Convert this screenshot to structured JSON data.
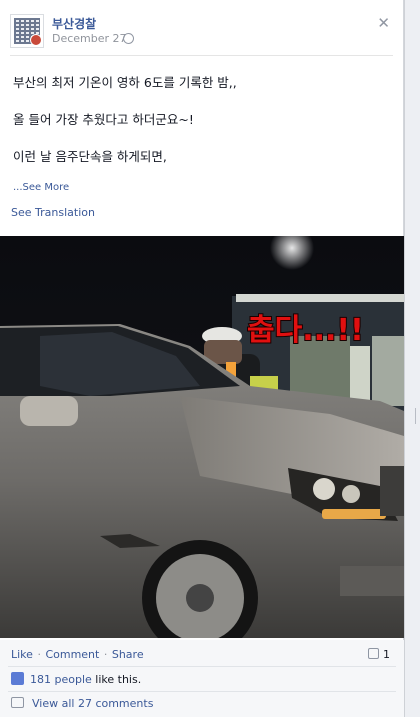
{
  "post": {
    "page_name": "부산경찰",
    "date": "December 27",
    "close_icon": "close-icon",
    "privacy_icon": "globe-icon",
    "lines": [
      "부산의 최저 기온이 영하 6도를 기록한 밤,,",
      "올 들어 가장 추웠다고 하더군요~!",
      "이런 날 음주단속을 하게되면,"
    ],
    "see_more": "...See More",
    "see_translation": "See Translation"
  },
  "photo": {
    "caption": "춥다...!!"
  },
  "actions": {
    "like": "Like",
    "comment": "Comment",
    "share": "Share",
    "comment_count": "1"
  },
  "likes": {
    "count_link": "181 people",
    "suffix": " like this."
  },
  "comments": {
    "view_all": "View all 27 comments"
  },
  "colors": {
    "link": "#3b5998",
    "caption_red": "#e01010"
  }
}
